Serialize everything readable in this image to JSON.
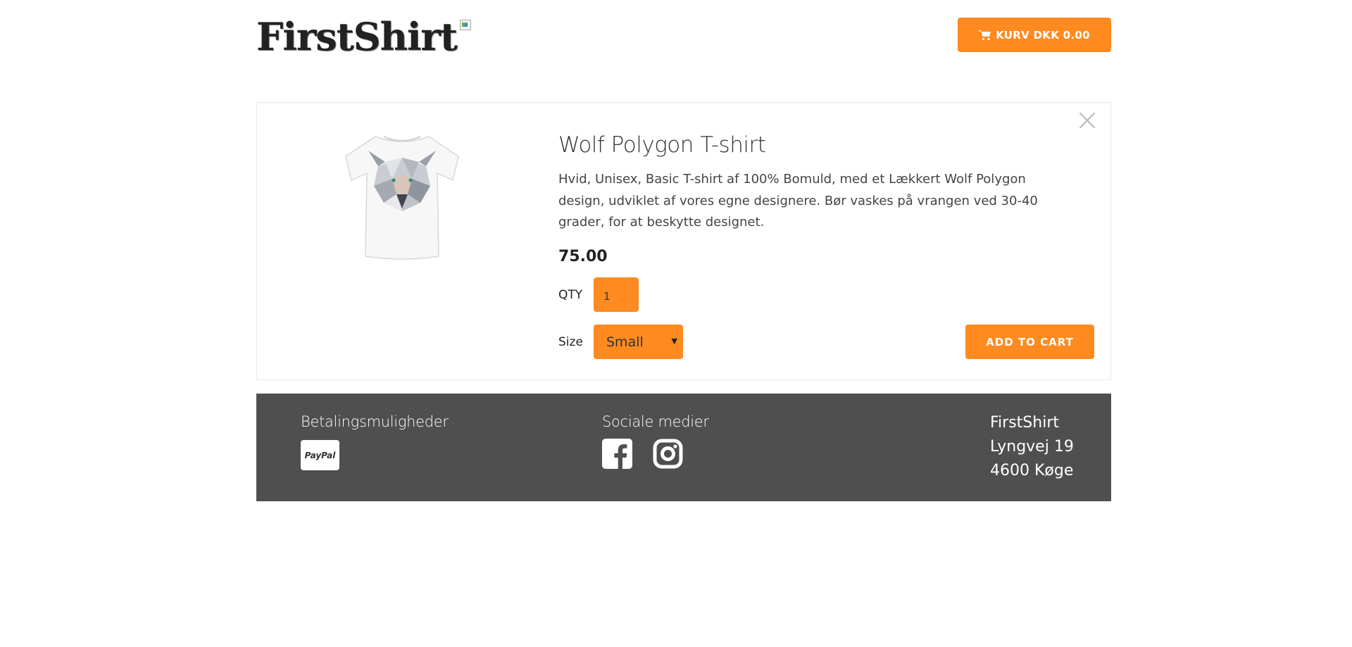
{
  "header": {
    "logo_text": "FirstShirt",
    "cart_label": "KURV DKK 0.00"
  },
  "product": {
    "title": "Wolf Polygon T-shirt",
    "description": "Hvid, Unisex, Basic T-shirt af 100% Bomuld, med et Lækkert Wolf Polygon design, udviklet af vores egne designere. Bør vaskes på vrangen ved 30-40 grader, for at beskytte designet.",
    "price": "75.00",
    "qty_label": "QTY",
    "qty_value": "1",
    "size_label": "Size",
    "size_selected": "Small",
    "add_to_cart_label": "ADD TO CART"
  },
  "footer": {
    "payment_title": "Betalingsmuligheder",
    "paypal_label": "PayPal",
    "social_title": "Sociale medier",
    "company_name": "FirstShirt",
    "street": "Lyngvej 19",
    "city": "4600 Køge"
  },
  "colors": {
    "accent": "#ff8a1f",
    "footer_bg": "#4f4f4f"
  },
  "icons": [
    "cart-icon",
    "close-icon",
    "facebook-icon",
    "instagram-icon"
  ]
}
